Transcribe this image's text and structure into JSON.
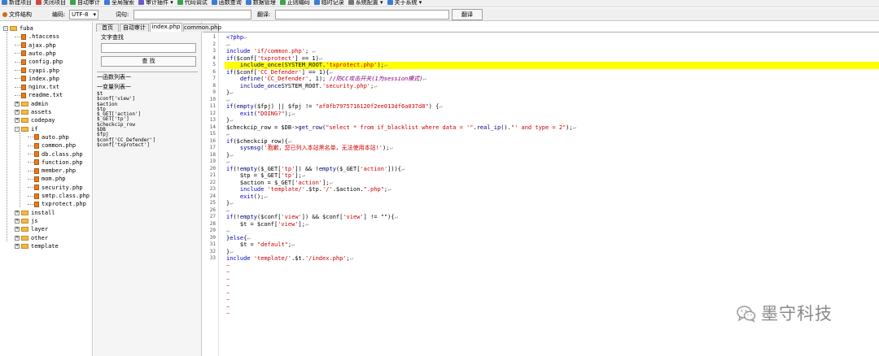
{
  "menubar": {
    "items": [
      {
        "label": "新建项目",
        "icon": "new-project-icon",
        "color": "#3a7bd5"
      },
      {
        "label": "关闭项目",
        "icon": "close-project-icon",
        "color": "#d64545"
      },
      {
        "label": "自动审计",
        "icon": "auto-audit-icon",
        "color": "#3aa34a"
      },
      {
        "label": "全局搜索",
        "icon": "global-search-icon",
        "color": "#3a7bd5"
      },
      {
        "label": "审计插件 ▾",
        "icon": "plugin-icon",
        "color": "#6a5acd"
      },
      {
        "label": "代码调试",
        "icon": "debug-icon",
        "color": "#3aa34a"
      },
      {
        "label": "函数查询",
        "icon": "function-query-icon",
        "color": "#3a7bd5"
      },
      {
        "label": "数据管理",
        "icon": "data-manage-icon",
        "color": "#3a7bd5"
      },
      {
        "label": "正则编码",
        "icon": "regex-icon",
        "color": "#3aa34a"
      },
      {
        "label": "临时记录",
        "icon": "notes-icon",
        "color": "#3a7bd5"
      },
      {
        "label": "系统配置 ▾",
        "icon": "settings-icon",
        "color": "#777777"
      },
      {
        "label": "关于系统 ▾",
        "icon": "about-icon",
        "color": "#3a7bd5"
      }
    ]
  },
  "toolbar": {
    "file_structure": "文件结构",
    "encoding_label": "编码:",
    "encoding_value": "UTF-8",
    "word_label": "词句:",
    "word_value": "",
    "translate_label": "翻译:",
    "translate_value": "",
    "translate_button": "翻译"
  },
  "tree": {
    "root": "fuba",
    "items": [
      {
        "name": ".htaccess",
        "type": "file",
        "depth": 1
      },
      {
        "name": "ajax.php",
        "type": "file",
        "depth": 1
      },
      {
        "name": "auto.php",
        "type": "file",
        "depth": 1
      },
      {
        "name": "config.php",
        "type": "file",
        "depth": 1
      },
      {
        "name": "cyapi.php",
        "type": "file",
        "depth": 1
      },
      {
        "name": "index.php",
        "type": "file",
        "depth": 1
      },
      {
        "name": "nginx.txt",
        "type": "file",
        "depth": 1
      },
      {
        "name": "readme.txt",
        "type": "file",
        "depth": 1
      },
      {
        "name": "admin",
        "type": "folder",
        "depth": 1
      },
      {
        "name": "assets",
        "type": "folder",
        "depth": 1
      },
      {
        "name": "codepay",
        "type": "folder",
        "depth": 1
      },
      {
        "name": "if",
        "type": "folder-open",
        "depth": 1
      },
      {
        "name": "auto.php",
        "type": "file",
        "depth": 2
      },
      {
        "name": "common.php",
        "type": "file",
        "depth": 2
      },
      {
        "name": "db.class.php",
        "type": "file",
        "depth": 2
      },
      {
        "name": "function.php",
        "type": "file",
        "depth": 2
      },
      {
        "name": "member.php",
        "type": "file",
        "depth": 2
      },
      {
        "name": "mom.php",
        "type": "file",
        "depth": 2
      },
      {
        "name": "security.php",
        "type": "file",
        "depth": 2
      },
      {
        "name": "smtp.class.php",
        "type": "file",
        "depth": 2
      },
      {
        "name": "txprotect.php",
        "type": "file",
        "depth": 2
      },
      {
        "name": "install",
        "type": "folder",
        "depth": 1
      },
      {
        "name": "js",
        "type": "folder",
        "depth": 1
      },
      {
        "name": "layer",
        "type": "folder",
        "depth": 1
      },
      {
        "name": "other",
        "type": "folder",
        "depth": 1
      },
      {
        "name": "template",
        "type": "folder",
        "depth": 1
      }
    ]
  },
  "tabs": [
    "首页",
    "自动审计",
    "index.php",
    "common.php"
  ],
  "active_tab": 2,
  "search_panel": {
    "title": "文字查找",
    "search_input": "",
    "find_button": "查 找",
    "func_list_title": "一函数列表一",
    "var_list_title": "一变量列表一",
    "variables": [
      "$t",
      "$conf['view']",
      "$action",
      "$tp",
      "$_GET['action']",
      "$_GET['tp']",
      "$checkcip_row",
      "$DB",
      "$fpj",
      "$conf['CC_Defender']",
      "$conf['txprotect']"
    ]
  },
  "code": {
    "highlight_line": 5,
    "lines": [
      [
        [
          "kw",
          "<?php"
        ],
        [
          "pl",
          "↵"
        ]
      ],
      [
        [
          "pl",
          "↵"
        ]
      ],
      [
        [
          "kw",
          "include"
        ],
        [
          "st",
          " 'if/common.php'"
        ],
        [
          "",
          "; "
        ],
        [
          "pl",
          "↵"
        ]
      ],
      [
        [
          "kw",
          "if"
        ],
        [
          "",
          "($conf["
        ],
        [
          "st",
          "'txprotect'"
        ],
        [
          "",
          "] == 1)"
        ],
        [
          "pl",
          "↵"
        ]
      ],
      [
        [
          "",
          "    "
        ],
        [
          "fn",
          "include_once"
        ],
        [
          "",
          "(SYSTEM_ROOT."
        ],
        [
          "st",
          "'txprotect.php'"
        ],
        [
          "",
          ");"
        ],
        [
          "pl",
          "↵"
        ]
      ],
      [
        [
          "kw",
          "if"
        ],
        [
          "",
          "($conf["
        ],
        [
          "st",
          "'CC_Defender'"
        ],
        [
          "",
          "] == 1){"
        ],
        [
          "pl",
          "↵"
        ]
      ],
      [
        [
          "",
          "    "
        ],
        [
          "fn",
          "define"
        ],
        [
          "",
          "("
        ],
        [
          "st",
          "'CC_Defender'"
        ],
        [
          "",
          ", 1); "
        ],
        [
          "cm",
          "//防CC攻击开关(1为session模式)"
        ],
        [
          "pl",
          "↵"
        ]
      ],
      [
        [
          "",
          "    "
        ],
        [
          "fn",
          "include_once"
        ],
        [
          "",
          ""
        ],
        [
          "",
          ""
        ],
        [
          "",
          "SYSTEM_ROOT."
        ],
        [
          "st",
          "'security.php'"
        ],
        [
          "",
          ";"
        ],
        [
          "pl",
          "↵"
        ]
      ],
      [
        [
          "",
          "}"
        ],
        [
          "pl",
          "↵"
        ]
      ],
      [
        [
          "pl",
          "↵"
        ]
      ],
      [
        [
          "kw",
          "if"
        ],
        [
          "",
          "("
        ],
        [
          "fn",
          "empty"
        ],
        [
          "",
          "($fpj) || $fpj != "
        ],
        [
          "st",
          "\"af0fb7975716120f2ee013df6a037d8\""
        ],
        [
          "",
          ") {"
        ],
        [
          "pl",
          "↵"
        ]
      ],
      [
        [
          "",
          "    "
        ],
        [
          "kw",
          "exit"
        ],
        [
          "",
          "("
        ],
        [
          "st",
          "\"DOING?\""
        ],
        [
          "",
          ");"
        ],
        [
          "pl",
          "↵"
        ]
      ],
      [
        [
          "",
          "}"
        ],
        [
          "pl",
          "↵"
        ]
      ],
      [
        [
          "",
          "$checkcip_row = $DB->"
        ],
        [
          "fn",
          "get_row"
        ],
        [
          "",
          "("
        ],
        [
          "st",
          "\"select * from if_blacklist where data = '\""
        ],
        [
          "",
          "."
        ],
        [
          "fn",
          "real_ip"
        ],
        [
          "",
          "()."
        ],
        [
          "st",
          "\"' and type = 2\""
        ],
        [
          "",
          ");"
        ],
        [
          "pl",
          "↵"
        ]
      ],
      [
        [
          "pl",
          "↵"
        ]
      ],
      [
        [
          "kw",
          "if"
        ],
        [
          "",
          "($checkcip_row){"
        ],
        [
          "pl",
          "↵"
        ]
      ],
      [
        [
          "",
          "    "
        ],
        [
          "fn",
          "sysmsg"
        ],
        [
          "",
          "("
        ],
        [
          "st",
          "'抱歉，您已列入本站黑名单，无法使用本站!'"
        ],
        [
          "",
          ");"
        ],
        [
          "pl",
          "↵"
        ]
      ],
      [
        [
          "",
          "}"
        ],
        [
          "pl",
          "↵"
        ]
      ],
      [
        [
          "pl",
          "↵"
        ]
      ],
      [
        [
          "kw",
          "if"
        ],
        [
          "",
          "(!"
        ],
        [
          "fn",
          "empty"
        ],
        [
          "",
          "($_GET["
        ],
        [
          "st",
          "'tp'"
        ],
        [
          "",
          "]) && !"
        ],
        [
          "fn",
          "empty"
        ],
        [
          "",
          "($_GET["
        ],
        [
          "st",
          "'action'"
        ],
        [
          "",
          "])){"
        ],
        [
          "pl",
          "↵"
        ]
      ],
      [
        [
          "",
          "    $tp = $_GET["
        ],
        [
          "st",
          "'tp'"
        ],
        [
          "",
          "];"
        ],
        [
          "pl",
          "↵"
        ]
      ],
      [
        [
          "",
          "    $action = $_GET["
        ],
        [
          "st",
          "'action'"
        ],
        [
          "",
          "];"
        ],
        [
          "pl",
          "↵"
        ]
      ],
      [
        [
          "",
          "    "
        ],
        [
          "kw",
          "include"
        ],
        [
          "",
          ""
        ],
        [
          "st",
          " 'template/'"
        ],
        [
          "",
          ".$tp."
        ],
        [
          "st",
          "'/'"
        ],
        [
          "",
          ".$action."
        ],
        [
          "st",
          "\".php\""
        ],
        [
          "",
          ";"
        ],
        [
          "pl",
          "↵"
        ]
      ],
      [
        [
          "",
          "    "
        ],
        [
          "kw",
          "exit"
        ],
        [
          "",
          "();"
        ],
        [
          "pl",
          "↵"
        ]
      ],
      [
        [
          "",
          "}"
        ],
        [
          "pl",
          "↵"
        ]
      ],
      [
        [
          "pl",
          "↵"
        ]
      ],
      [
        [
          "kw",
          "if"
        ],
        [
          "",
          "(!"
        ],
        [
          "fn",
          "empty"
        ],
        [
          "",
          "($conf["
        ],
        [
          "st",
          "'view'"
        ],
        [
          "",
          "]) && $conf["
        ],
        [
          "st",
          "'view'"
        ],
        [
          "",
          "] != \"\"){"
        ],
        [
          "pl",
          "↵"
        ]
      ],
      [
        [
          "",
          "    $t = $conf["
        ],
        [
          "st",
          "'view'"
        ],
        [
          "",
          "];"
        ],
        [
          "pl",
          "↵"
        ]
      ],
      [
        [
          "pl",
          "↵"
        ]
      ],
      [
        [
          "",
          "}"
        ],
        [
          "kw",
          "else"
        ],
        [
          "",
          "{"
        ],
        [
          "pl",
          "↵"
        ]
      ],
      [
        [
          "",
          "    $t = "
        ],
        [
          "st",
          "\"default\""
        ],
        [
          "",
          ";"
        ],
        [
          "pl",
          "↵"
        ]
      ],
      [
        [
          "",
          "}"
        ],
        [
          "pl",
          "↵"
        ]
      ],
      [
        [
          "kw",
          "include"
        ],
        [
          "st",
          " 'template/'"
        ],
        [
          "",
          ".$t."
        ],
        [
          "st",
          "'/index.php'"
        ],
        [
          "",
          ";"
        ],
        [
          "pl",
          "↵"
        ]
      ]
    ],
    "trailing_markers": 8
  },
  "watermark": {
    "text": "墨守科技",
    "icon": "wechat-logo-icon"
  }
}
